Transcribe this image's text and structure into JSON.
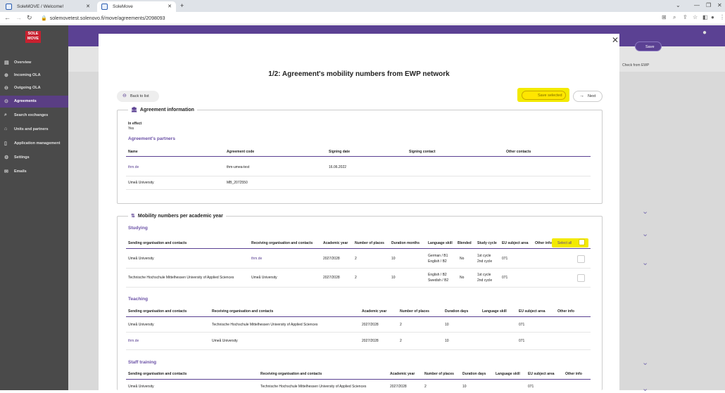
{
  "browser": {
    "tabs": [
      {
        "title": "SoleMOVE / Welcome!"
      },
      {
        "title": "SoleMove"
      }
    ],
    "url": "solemovetest.solenovo.fi/move/agreements/2098093"
  },
  "sidebar": {
    "logo": "SOLE MOVE",
    "items": [
      "Overview",
      "Incoming OLA",
      "Outgoing OLA",
      "Agreements",
      "Search exchanges",
      "Units and partners",
      "Application management",
      "Settings",
      "Emails"
    ]
  },
  "background": {
    "save": "Save",
    "check_ewp": "Check from EWP"
  },
  "modal": {
    "title": "1/2: Agreement's mobility numbers from EWP network",
    "back": "Back to list",
    "save_selected": "Save selected",
    "next": "Next",
    "agreement": {
      "legend": "Agreement information",
      "status_label": "In effect",
      "status_value": "Yes",
      "partners_title": "Agreement's partners",
      "headers": [
        "Name",
        "Agreement code",
        "Signing date",
        "Signing contact",
        "Other contacts"
      ],
      "rows": [
        [
          "thm.de",
          "thm-umea-test",
          "16.06.2022",
          "",
          ""
        ],
        [
          "Umeå University",
          "MB_2072550",
          "",
          "",
          ""
        ]
      ]
    },
    "mobility": {
      "legend": "Mobility numbers per academic year",
      "studying": {
        "title": "Studying",
        "headers": [
          "Sending organisation and contacts",
          "Receiving organisation and contacts",
          "Academic year",
          "Number of places",
          "Duration months",
          "Language skill",
          "Blended",
          "Study cycle",
          "EU subject area",
          "Other info"
        ],
        "select_all": "Select all",
        "rows": [
          {
            "sending": "Umeå University",
            "receiving": "thm.de",
            "year": "2027/2028",
            "places": "2",
            "duration": "10",
            "lang1": "German / B1",
            "lang2": "English / B2",
            "blended": "No",
            "cycle1": "1st cycle",
            "cycle2": "2nd cycle",
            "eu": "071"
          },
          {
            "sending": "Technische Hochschule Mittelhessen University of Applied Sciences",
            "receiving": "Umeå University",
            "year": "2027/2028",
            "places": "2",
            "duration": "10",
            "lang1": "English / B2",
            "lang2": "Swedish / B2",
            "blended": "No",
            "cycle1": "1st cycle",
            "cycle2": "2nd cycle",
            "eu": "071"
          }
        ]
      },
      "teaching": {
        "title": "Teaching",
        "headers": [
          "Sending organisation and contacts",
          "Receiving organisation and contacts",
          "Academic year",
          "Number of places",
          "Duration days",
          "Language skill",
          "EU subject area",
          "Other info"
        ],
        "rows": [
          {
            "sending": "Umeå University",
            "receiving": "Technische Hochschule Mittelhessen University of Applied Sciences",
            "year": "2027/2028",
            "places": "2",
            "duration": "10",
            "eu": "071"
          },
          {
            "sending": "thm.de",
            "receiving": "Umeå University",
            "year": "2027/2028",
            "places": "2",
            "duration": "10",
            "eu": "071"
          }
        ]
      },
      "staff": {
        "title": "Staff training",
        "headers": [
          "Sending organisation and contacts",
          "Receiving organisation and contacts",
          "Academic year",
          "Number of places",
          "Duration days",
          "Language skill",
          "EU subject area",
          "Other info"
        ],
        "rows": [
          {
            "sending": "Umeå University",
            "receiving": "Technische Hochschule Mittelhessen University of Applied Sciences",
            "year": "2027/2028",
            "places": "2",
            "duration": "10",
            "eu": "071"
          }
        ]
      }
    }
  }
}
